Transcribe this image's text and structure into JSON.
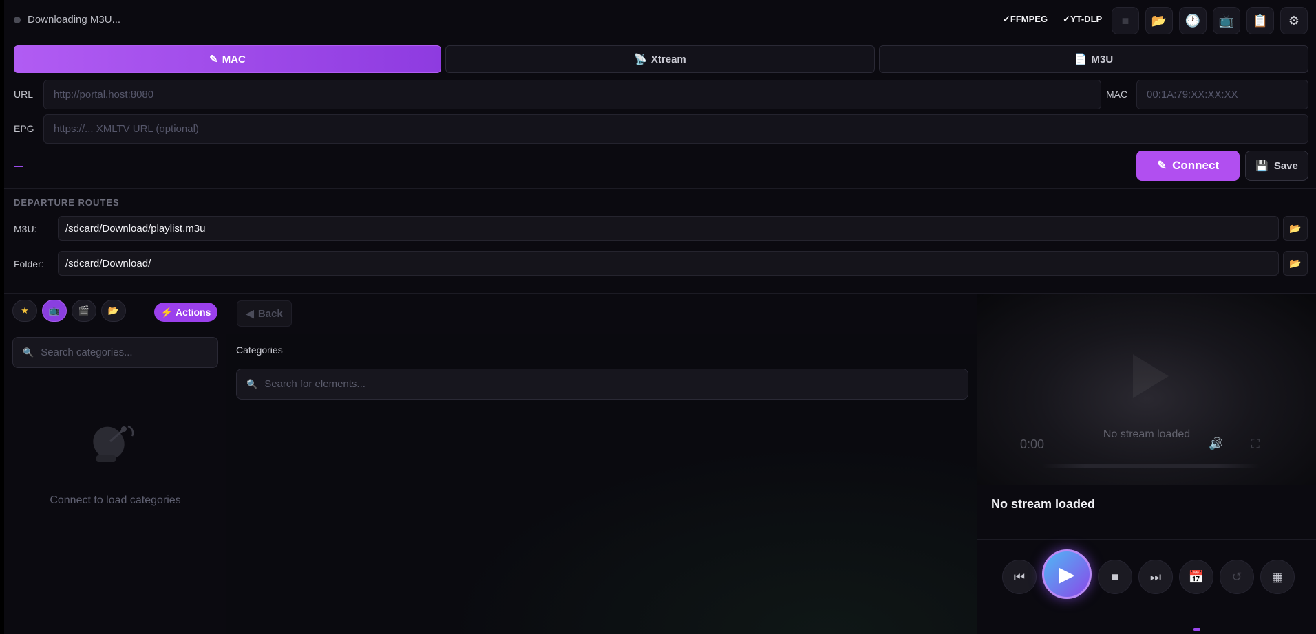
{
  "status": {
    "text": "Downloading M3U..."
  },
  "deps": [
    {
      "label": "✓FFMPEG"
    },
    {
      "label": "✓YT-DLP"
    }
  ],
  "toolbar": {
    "buttons": [
      {
        "name": "stop-icon",
        "glyph": "■"
      },
      {
        "name": "folder-icon",
        "glyph": "📂"
      },
      {
        "name": "clock-icon",
        "glyph": "🕐"
      },
      {
        "name": "tv-icon",
        "glyph": "📺"
      },
      {
        "name": "clipboard-icon",
        "glyph": "📋"
      },
      {
        "name": "gear-icon",
        "glyph": "⚙"
      }
    ]
  },
  "tabs": [
    {
      "icon": "✎",
      "label": "MAC",
      "active": true
    },
    {
      "icon": "📡",
      "label": "Xtream",
      "active": false
    },
    {
      "icon": "📄",
      "label": "M3U",
      "active": false
    }
  ],
  "form": {
    "url_label": "URL",
    "url_placeholder": "http://portal.host:8080",
    "mac_label": "MAC",
    "mac_placeholder": "00:1A:79:XX:XX:XX",
    "epg_label": "EPG",
    "epg_placeholder": "https://... XMLTV URL (optional)",
    "connect_label": "Connect",
    "save_label": "Save"
  },
  "routes": {
    "title": "DEPARTURE ROUTES",
    "m3u_label": "M3U:",
    "m3u_value": "/sdcard/Download/playlist.m3u",
    "folder_label": "Folder:",
    "folder_value": "/sdcard/Download/"
  },
  "left": {
    "chips": [
      {
        "name": "favorites-icon",
        "glyph": "★"
      },
      {
        "name": "live-tv-icon",
        "glyph": "📺"
      },
      {
        "name": "movies-icon",
        "glyph": "🎬"
      },
      {
        "name": "folder-icon",
        "glyph": "📂"
      }
    ],
    "actions_label": "Actions",
    "search_placeholder": "Search categories...",
    "empty_text": "Connect to load categories"
  },
  "middle": {
    "back_label": "Back",
    "title": "Categories",
    "search_placeholder": "Search for elements..."
  },
  "player": {
    "time": "0:00",
    "overlay_text": "No stream loaded",
    "info_title": "No stream loaded",
    "info_sub": "–"
  },
  "colors": {
    "accent": "#b14ff0",
    "background": "#0b0a10"
  }
}
